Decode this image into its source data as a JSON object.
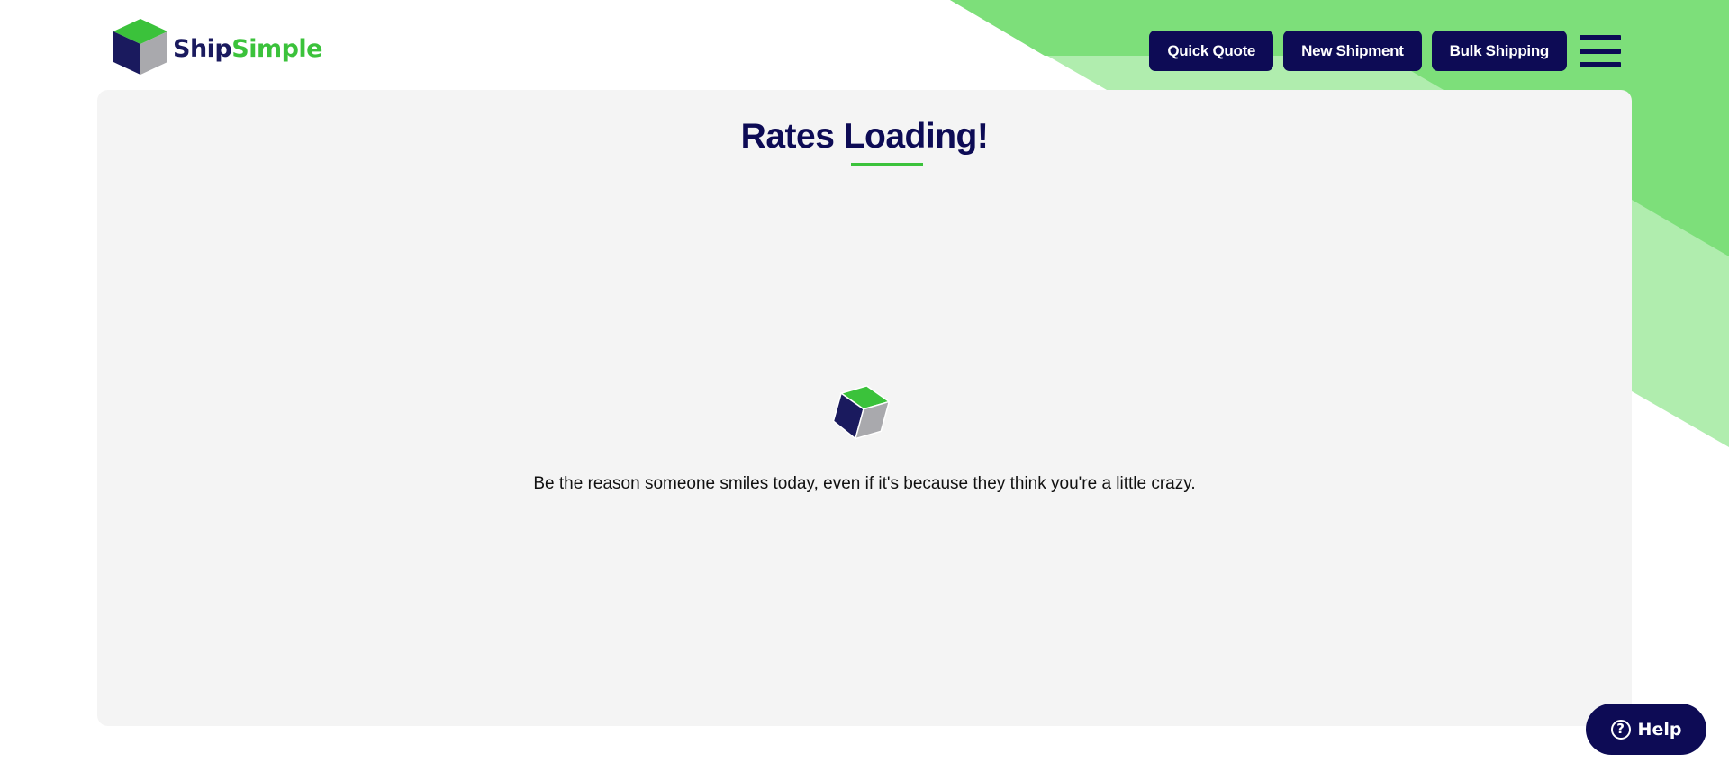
{
  "brand": {
    "name_part1": "Ship",
    "name_part2": "Simple",
    "colors": {
      "navy": "#0d0b55",
      "green": "#3bc23b",
      "light_green": "#b0edae",
      "mid_green": "#7ddf7a",
      "card_bg": "#f4f4f4"
    }
  },
  "nav": {
    "quick_quote_label": "Quick Quote",
    "new_shipment_label": "New Shipment",
    "bulk_shipping_label": "Bulk Shipping",
    "menu_icon": "hamburger-icon"
  },
  "main": {
    "title": "Rates Loading!",
    "loading_icon": "cube-spinner-icon",
    "message": "Be the reason someone smiles today, even if it's because they think you're a little crazy."
  },
  "help": {
    "label": "Help",
    "icon": "question-circle-icon",
    "icon_glyph": "?"
  }
}
